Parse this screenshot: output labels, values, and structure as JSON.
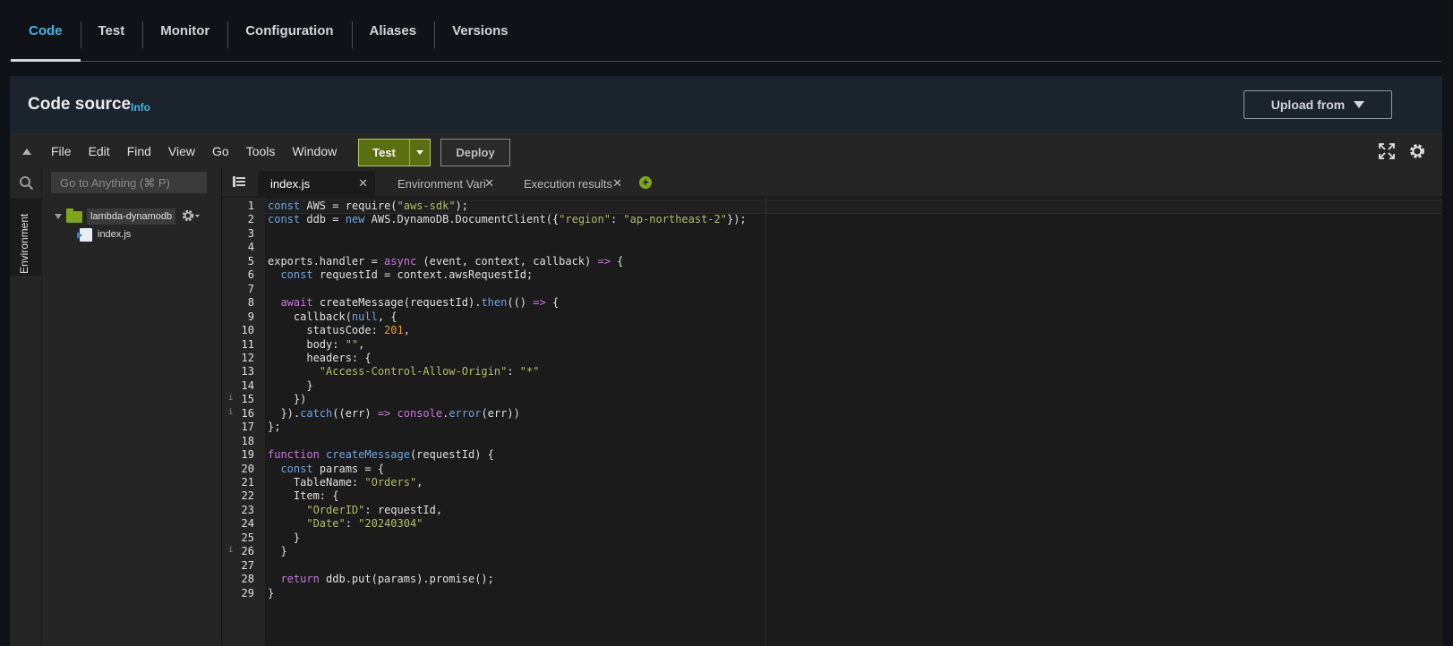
{
  "top_tabs": [
    {
      "label": "Code",
      "active": true
    },
    {
      "label": "Test"
    },
    {
      "label": "Monitor"
    },
    {
      "label": "Configuration"
    },
    {
      "label": "Aliases"
    },
    {
      "label": "Versions"
    }
  ],
  "panel": {
    "title": "Code source",
    "info": "Info",
    "upload_label": "Upload from"
  },
  "ide": {
    "menu": [
      "File",
      "Edit",
      "Find",
      "View",
      "Go",
      "Tools",
      "Window"
    ],
    "test_label": "Test",
    "deploy_label": "Deploy",
    "side_label": "Environment",
    "goto_placeholder": "Go to Anything (⌘ P)",
    "folder_name": "lambda-dynamodb",
    "file_name": "index.js",
    "editor_tabs": [
      {
        "label": "index.js",
        "active": true
      },
      {
        "label": "Environment Vari"
      },
      {
        "label": "Execution results"
      }
    ],
    "colors": {
      "accent": "#42b4e6",
      "test_button": "#5a6f10",
      "folder": "#7fa51c"
    }
  },
  "code": {
    "lines": [
      [
        [
          "kw2",
          "const "
        ],
        [
          "p",
          "AWS = "
        ],
        [
          "p",
          "require("
        ],
        [
          "s",
          "\"aws-sdk\""
        ],
        [
          "p",
          ");"
        ]
      ],
      [
        [
          "kw2",
          "const "
        ],
        [
          "p",
          "ddb = "
        ],
        [
          "kw2",
          "new "
        ],
        [
          "p",
          "AWS.DynamoDB.DocumentClient({"
        ],
        [
          "s",
          "\"region\""
        ],
        [
          "p",
          ": "
        ],
        [
          "s",
          "\"ap-northeast-2\""
        ],
        [
          "p",
          "});"
        ]
      ],
      [],
      [],
      [
        [
          "p",
          "exports.handler = "
        ],
        [
          "kw",
          "async "
        ],
        [
          "p",
          "(event, context, callback) "
        ],
        [
          "kw",
          "=> "
        ],
        [
          "p",
          "{"
        ]
      ],
      [
        [
          "p",
          "  "
        ],
        [
          "kw2",
          "const "
        ],
        [
          "p",
          "requestId = context.awsRequestId;"
        ]
      ],
      [],
      [
        [
          "p",
          "  "
        ],
        [
          "kw",
          "await "
        ],
        [
          "p",
          "createMessage(requestId)."
        ],
        [
          "fn",
          "then"
        ],
        [
          "p",
          "(() "
        ],
        [
          "kw",
          "=> "
        ],
        [
          "p",
          "{"
        ]
      ],
      [
        [
          "p",
          "    callback("
        ],
        [
          "fn",
          "null"
        ],
        [
          "p",
          ", {"
        ]
      ],
      [
        [
          "p",
          "      statusCode: "
        ],
        [
          "n",
          "201"
        ],
        [
          "p",
          ","
        ]
      ],
      [
        [
          "p",
          "      body: "
        ],
        [
          "s",
          "\"\""
        ],
        [
          "p",
          ","
        ]
      ],
      [
        [
          "p",
          "      headers: {"
        ]
      ],
      [
        [
          "p",
          "        "
        ],
        [
          "s",
          "\"Access-Control-Allow-Origin\""
        ],
        [
          "p",
          ": "
        ],
        [
          "s",
          "\"*\""
        ]
      ],
      [
        [
          "p",
          "      }"
        ]
      ],
      [
        [
          "p",
          "    })"
        ]
      ],
      [
        [
          "p",
          "  })."
        ],
        [
          "fn",
          "catch"
        ],
        [
          "p",
          "((err) "
        ],
        [
          "kw",
          "=> "
        ],
        [
          "kw",
          "console"
        ],
        [
          "p",
          "."
        ],
        [
          "fn",
          "error"
        ],
        [
          "p",
          "(err))"
        ]
      ],
      [
        [
          "p",
          "};"
        ]
      ],
      [],
      [
        [
          "kw",
          "function "
        ],
        [
          "fn",
          "createMessage"
        ],
        [
          "p",
          "(requestId) {"
        ]
      ],
      [
        [
          "p",
          "  "
        ],
        [
          "kw2",
          "const "
        ],
        [
          "p",
          "params = {"
        ]
      ],
      [
        [
          "p",
          "    TableName: "
        ],
        [
          "s",
          "\"Orders\""
        ],
        [
          "p",
          ","
        ]
      ],
      [
        [
          "p",
          "    Item: {"
        ]
      ],
      [
        [
          "p",
          "      "
        ],
        [
          "s",
          "\"OrderID\""
        ],
        [
          "p",
          ": requestId,"
        ]
      ],
      [
        [
          "p",
          "      "
        ],
        [
          "s",
          "\"Date\""
        ],
        [
          "p",
          ": "
        ],
        [
          "s",
          "\"20240304\""
        ]
      ],
      [
        [
          "p",
          "    }"
        ]
      ],
      [
        [
          "p",
          "  }"
        ]
      ],
      [],
      [
        [
          "p",
          "  "
        ],
        [
          "kw",
          "return "
        ],
        [
          "p",
          "ddb.put(params).promise();"
        ]
      ],
      [
        [
          "p",
          "}"
        ]
      ]
    ],
    "warn_lines": [
      15,
      16,
      26
    ]
  }
}
